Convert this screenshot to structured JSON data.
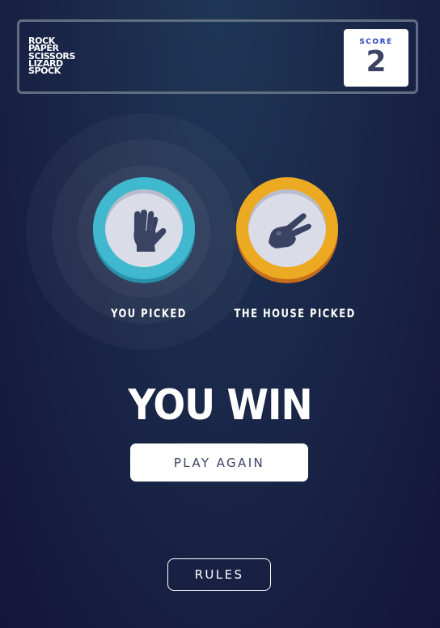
{
  "header": {
    "logo_lines": [
      "ROCK",
      "PAPER",
      "SCISSORS",
      "LIZARD",
      "SPOCK"
    ],
    "score_label": "SCORE",
    "score_value": "2"
  },
  "game": {
    "player_pick": "spock",
    "house_pick": "scissors",
    "player_label": "YOU PICKED",
    "house_label": "THE HOUSE PICKED",
    "result_text": "YOU WIN",
    "play_again_label": "PLAY AGAIN",
    "winner": "player"
  },
  "footer": {
    "rules_label": "RULES"
  },
  "icons": {
    "player_token_icon": "spock-hand-icon",
    "house_token_icon": "scissors-hand-icon"
  },
  "colors": {
    "background_top": "#1f3756",
    "background_bottom": "#141539",
    "header_outline": "#606e85",
    "spock_token": "#40b9ce",
    "scissors_token": "#eca922",
    "score_label": "#2a46c0",
    "dark_text": "#3b4363"
  }
}
